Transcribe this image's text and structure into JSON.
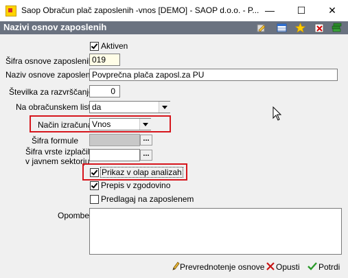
{
  "window": {
    "title": "Saop Obračun plač zaposlenih -vnos [DEMO] - SAOP d.o.o. - P...",
    "minimize": "—",
    "maximize": "☐",
    "close": "✕"
  },
  "form": {
    "title": "Nazivi osnov zaposlenih",
    "aktiven_label": "Aktiven",
    "aktiven_checked": true,
    "sifra_label": "Šifra osnove zaposlenih",
    "sifra_value": "019",
    "naziv_label": "Naziv osnove zaposlenih",
    "naziv_value": "Povprečna plača zaposl.za PU",
    "stevilka_label": "Številka  za razvrščanje",
    "stevilka_value": "0",
    "listu_label": "Na obračunskem listu",
    "listu_value": "da",
    "nacin_label": "Način izračuna",
    "nacin_value": "Vnos",
    "formule_label": "Šifra formule",
    "formule_value": "",
    "vrste_label_1": "Šifra vrste izplačila",
    "vrste_label_2": "v javnem sektorju",
    "vrste_value": "",
    "olap_label": "Prikaz v olap analizah",
    "olap_checked": true,
    "zgodovino_label": "Prepis v zgodovino",
    "zgodovino_checked": true,
    "predlagaj_label": "Predlagaj na zaposlenem",
    "predlagaj_checked": false,
    "opombe_label": "Opombe",
    "opombe_value": "",
    "ellipsis": "..."
  },
  "buttons": {
    "prevrednotenje": "Prevrednotenje osnove",
    "opusti": "Opusti",
    "potrdi": "Potrdi"
  },
  "colors": {
    "header_bg": "#6a7280",
    "highlight": "#d6151c",
    "sifra_bg": "#fffde7"
  }
}
